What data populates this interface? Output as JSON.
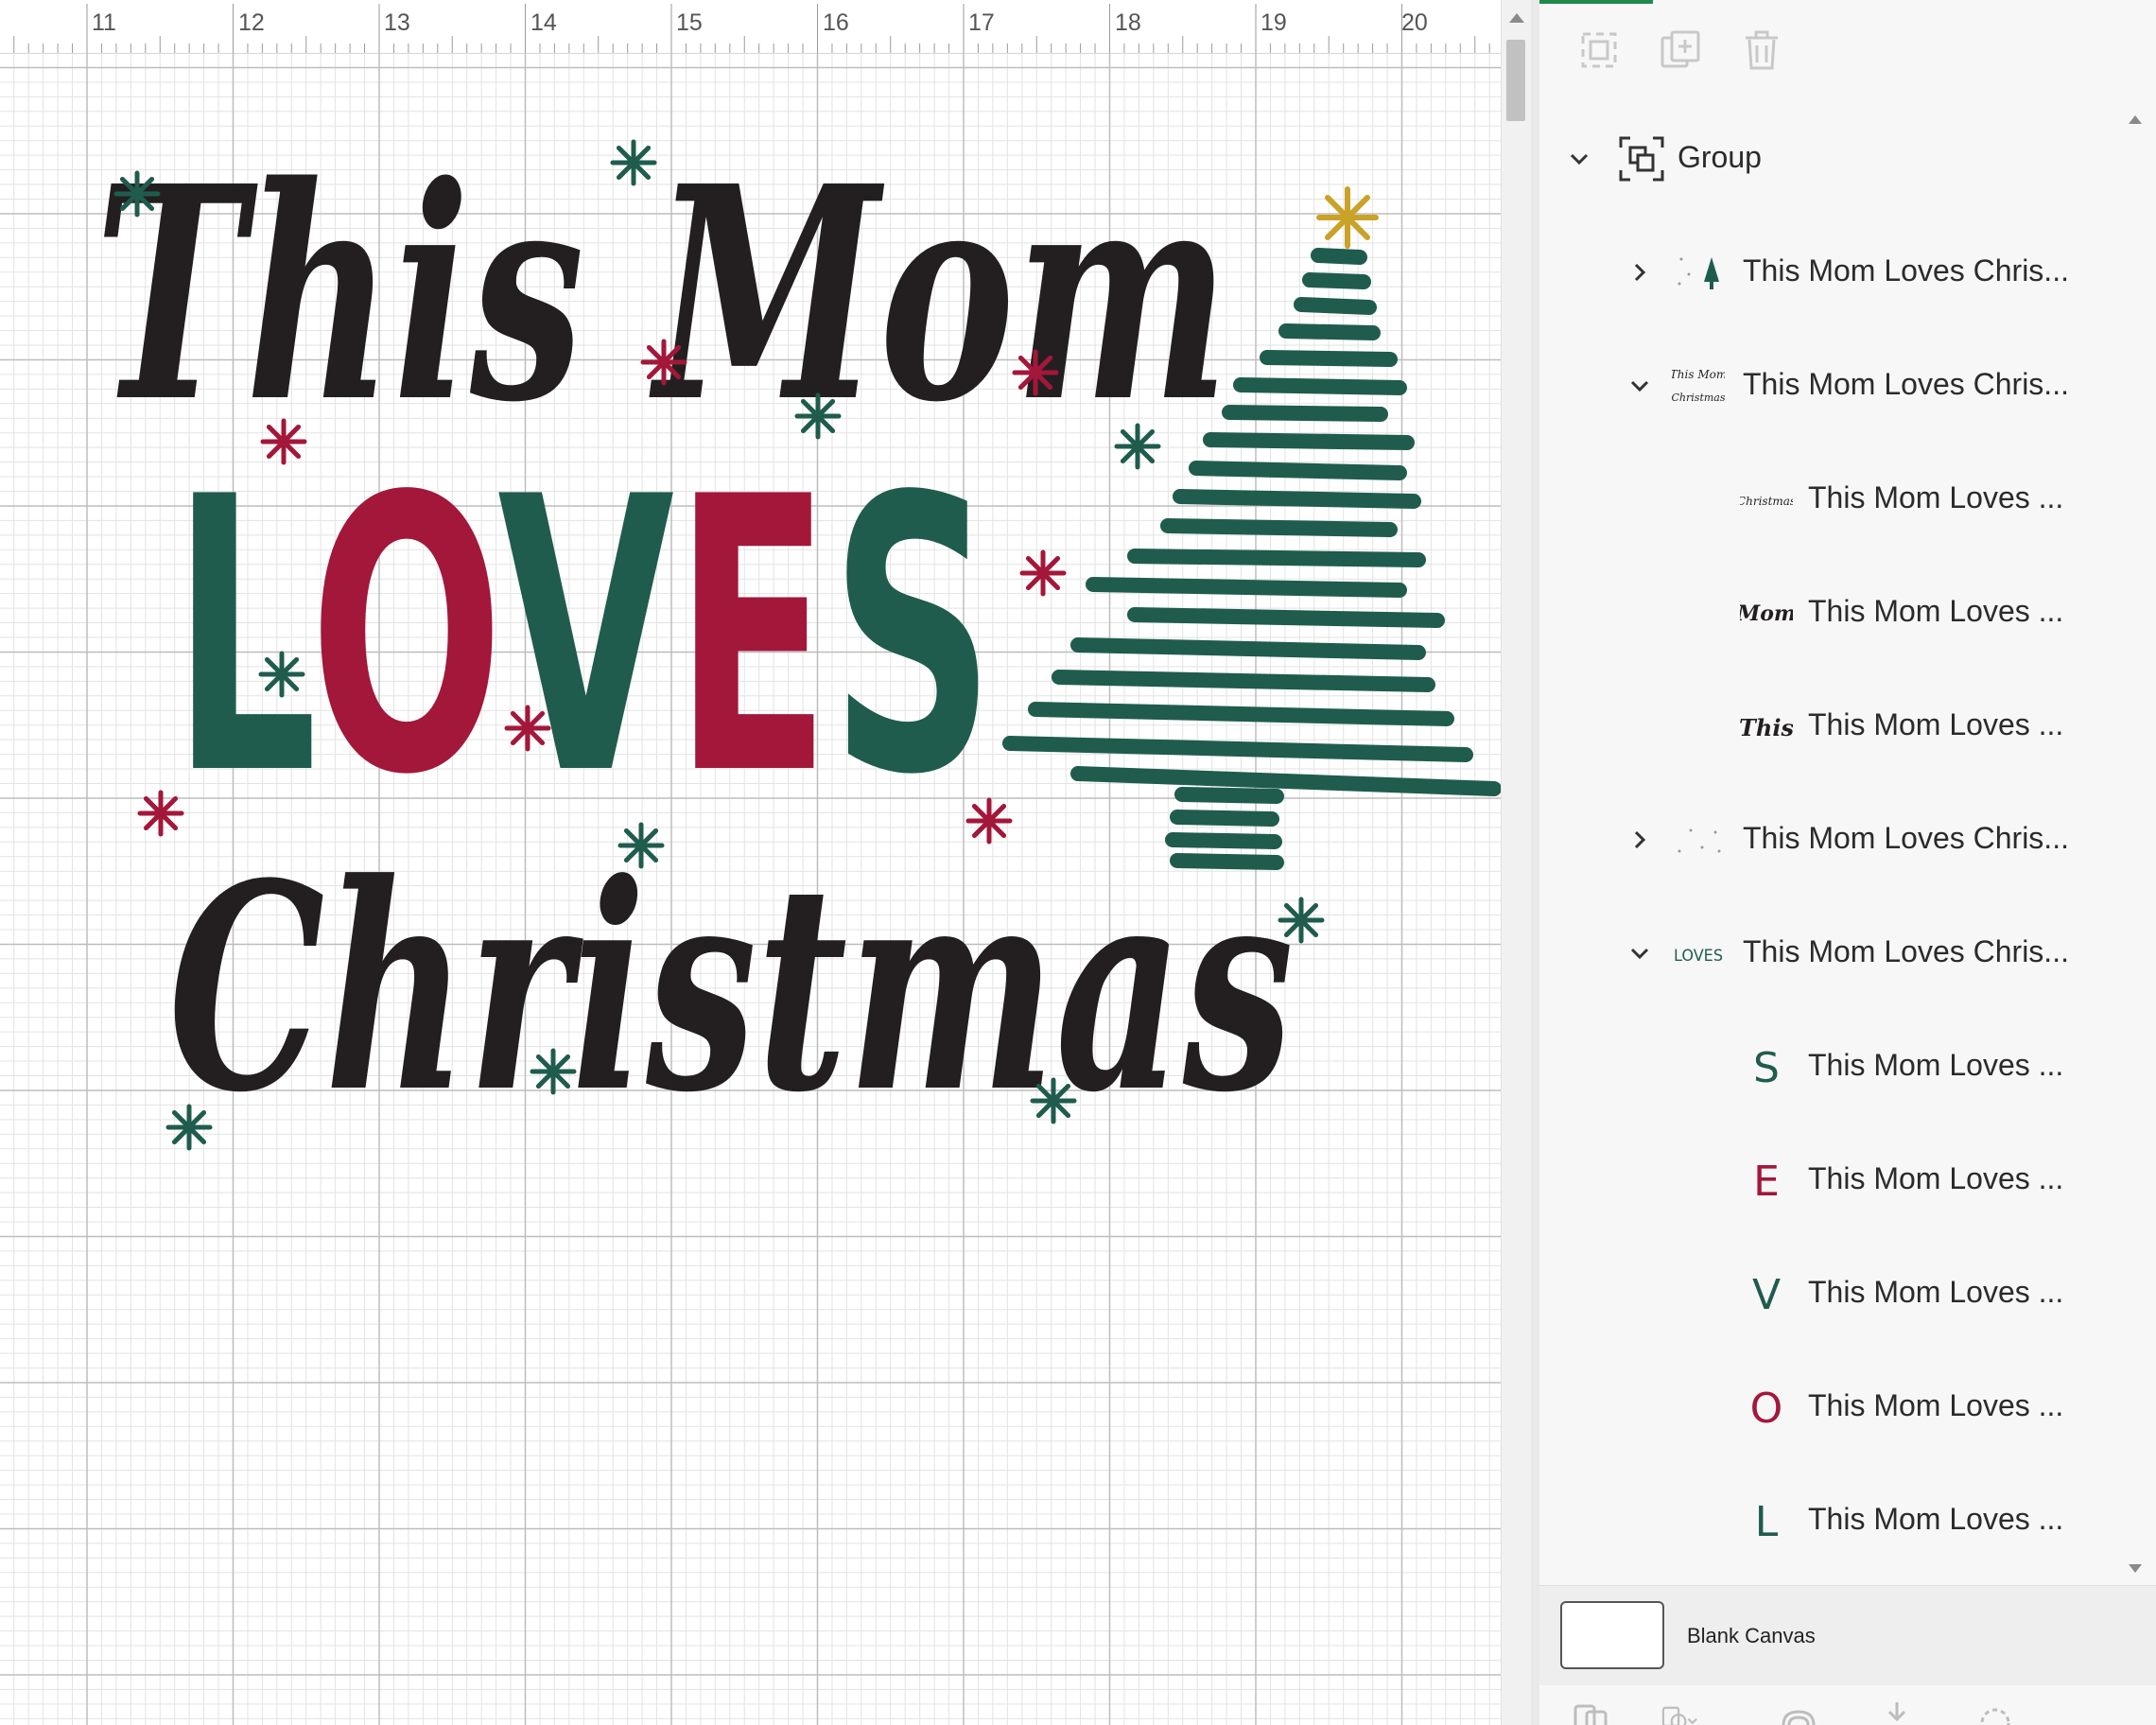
{
  "ruler": {
    "labels": [
      "11",
      "12",
      "13",
      "14",
      "15",
      "16",
      "17",
      "18",
      "19",
      "20"
    ]
  },
  "artwork": {
    "line1": "This Mom",
    "line2": "LOVES",
    "line3": "Christmas",
    "colors": {
      "black": "#231f20",
      "green": "#1f5c4e",
      "red": "#a3173a",
      "gold": "#c9a227"
    }
  },
  "toolbar": {
    "icons": [
      "ungroup-icon",
      "duplicate-icon",
      "delete-icon"
    ]
  },
  "layers": {
    "group_label": "Group",
    "items": [
      {
        "label": "This Mom Loves Chris...",
        "chevron": "right",
        "thumb": "tree-thumb"
      },
      {
        "label": "This Mom Loves Chris...",
        "chevron": "down",
        "thumb": "words-thumb"
      },
      {
        "label": "This Mom Loves ...",
        "chevron": "none",
        "thumb": "christmas-thumb",
        "thumb_text": "Christmas"
      },
      {
        "label": "This Mom Loves ...",
        "chevron": "none",
        "thumb": "mom-thumb",
        "thumb_text": "Mom"
      },
      {
        "label": "This Mom Loves ...",
        "chevron": "none",
        "thumb": "this-thumb",
        "thumb_text": "This"
      },
      {
        "label": "This Mom Loves Chris...",
        "chevron": "right",
        "thumb": "snowflakes-thumb"
      },
      {
        "label": "This Mom Loves Chris...",
        "chevron": "down",
        "thumb": "loves-thumb",
        "thumb_text": "LOVES"
      },
      {
        "label": "This Mom Loves ...",
        "chevron": "none",
        "thumb": "letter-s-thumb",
        "thumb_text": "S"
      },
      {
        "label": "This Mom Loves ...",
        "chevron": "none",
        "thumb": "letter-e-thumb",
        "thumb_text": "E"
      },
      {
        "label": "This Mom Loves ...",
        "chevron": "none",
        "thumb": "letter-v-thumb",
        "thumb_text": "V"
      },
      {
        "label": "This Mom Loves ...",
        "chevron": "none",
        "thumb": "letter-o-thumb",
        "thumb_text": "O"
      },
      {
        "label": "This Mom Loves ...",
        "chevron": "none",
        "thumb": "letter-l-thumb",
        "thumb_text": "L"
      }
    ]
  },
  "blank_canvas": {
    "label": "Blank Canvas"
  },
  "bottom_toolbar": {
    "icons": [
      "slice-icon",
      "combine-icon",
      "attach-icon",
      "flatten-icon",
      "contour-icon"
    ]
  }
}
